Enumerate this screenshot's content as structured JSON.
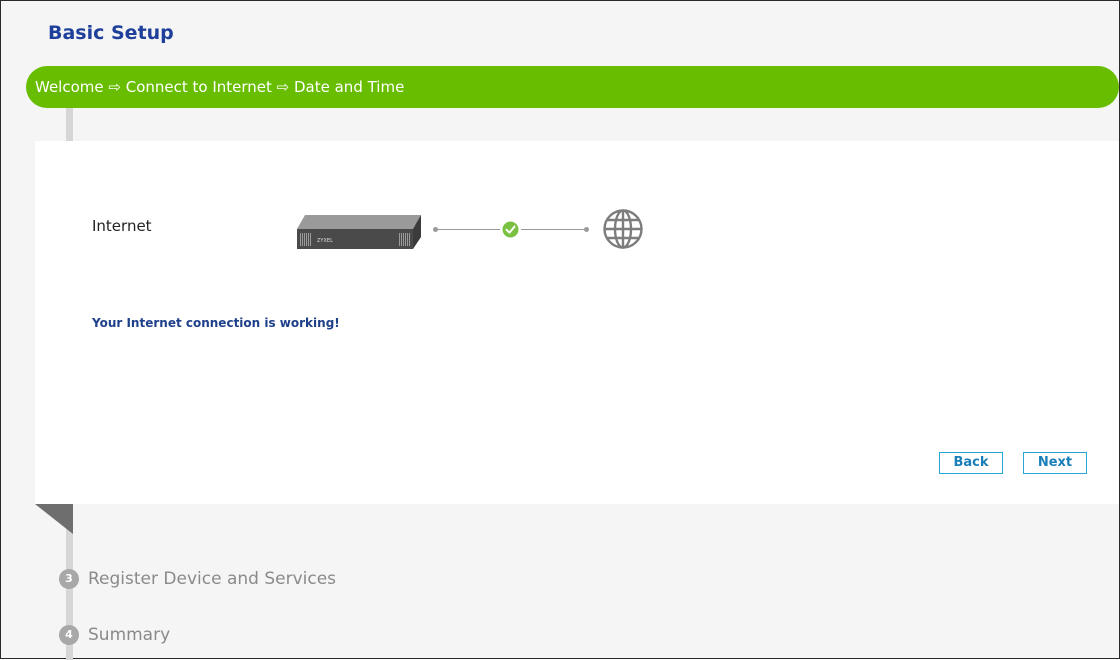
{
  "page": {
    "title": "Basic Setup"
  },
  "progress": {
    "steps_text": "Welcome ⇨ Connect to Internet ⇨ Date and Time"
  },
  "connection": {
    "label": "Internet",
    "device_brand": "ZYXEL",
    "status_message": "Your Internet connection is working!"
  },
  "buttons": {
    "back": "Back",
    "next": "Next"
  },
  "upcoming_steps": [
    {
      "number": "3",
      "label": "Register Device and Services"
    },
    {
      "number": "4",
      "label": "Summary"
    }
  ],
  "colors": {
    "accent_green": "#68bd00",
    "title_blue": "#1e3f9a",
    "button_blue": "#2aa5d8",
    "check_green": "#7ac143"
  }
}
